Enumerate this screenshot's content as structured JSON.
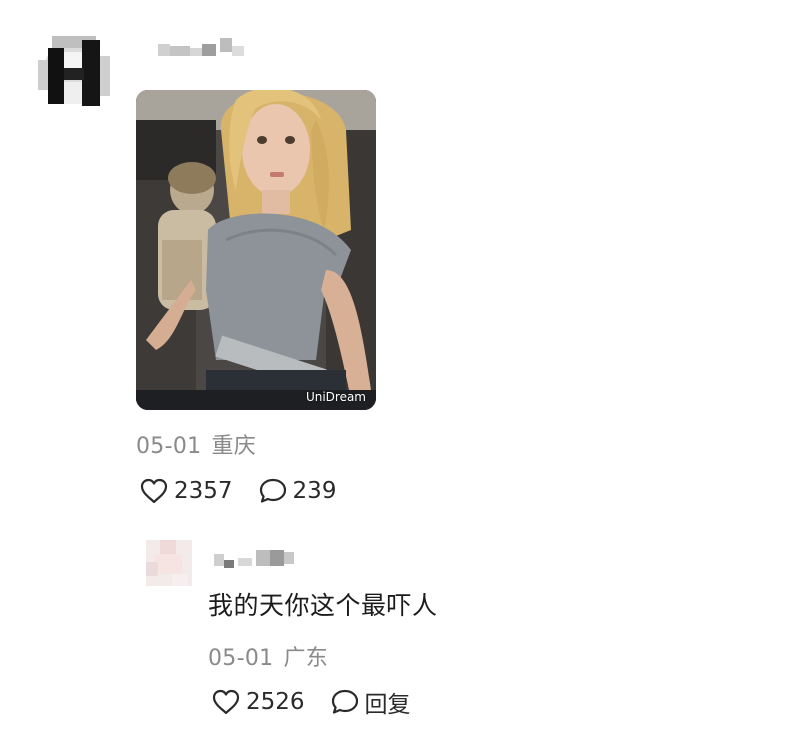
{
  "post": {
    "photo_watermark": "UniDream",
    "date": "05-01",
    "location": "重庆",
    "like_count": "2357",
    "comment_count": "239"
  },
  "reply": {
    "text": "我的天你这个最吓人",
    "date": "05-01",
    "location": "广东",
    "like_count": "2526",
    "reply_label": "回复"
  },
  "icons": {
    "like": "heart-outline-icon",
    "comment": "speech-bubble-icon"
  },
  "colors": {
    "meta_text": "#8a8a8a",
    "primary_text": "#1c1c1c"
  }
}
